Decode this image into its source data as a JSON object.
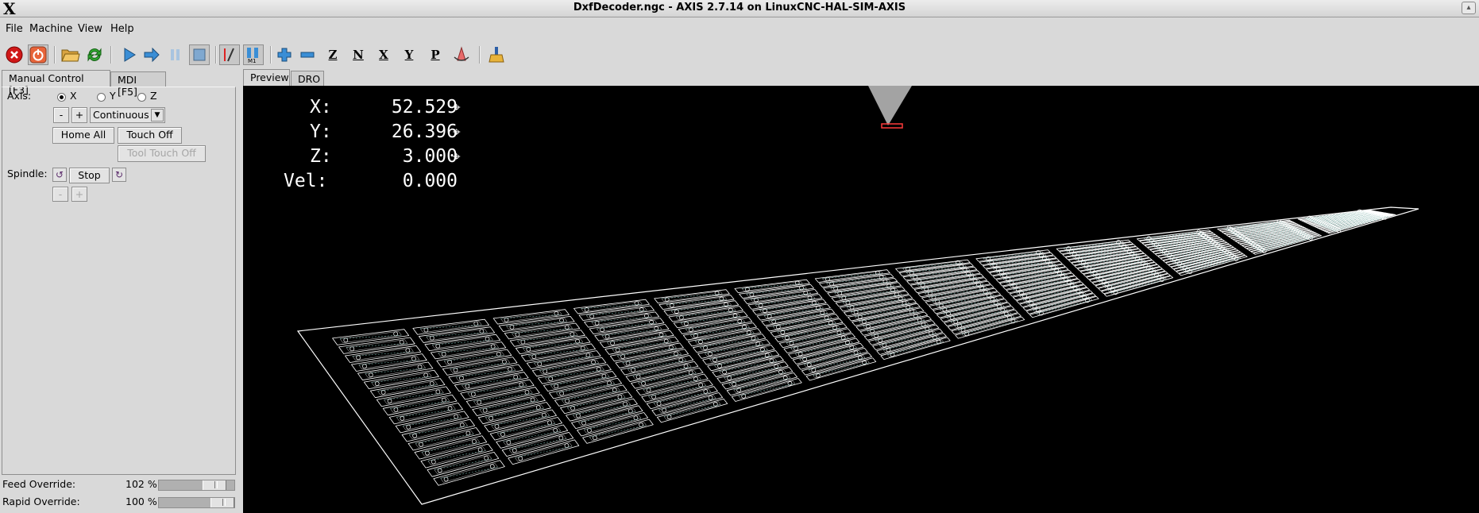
{
  "window": {
    "title": "DxfDecoder.ngc - AXIS 2.7.14 on LinuxCNC-HAL-SIM-AXIS",
    "logo": "X"
  },
  "menu": {
    "file": "File",
    "machine": "Machine",
    "view": "View",
    "help": "Help"
  },
  "toolbar": {
    "icons": [
      "estop-icon",
      "machine-power-icon",
      "open-file-icon",
      "reload-icon",
      "run-icon",
      "step-icon",
      "pause-icon",
      "stop-icon",
      "toggle-skip-lines-icon",
      "optional-stop-icon",
      "zoom-in-icon",
      "zoom-out-icon",
      "view-z-icon",
      "view-z2-icon",
      "view-x-icon",
      "view-y-icon",
      "view-p-icon",
      "rotate-view-icon",
      "clear-plot-icon"
    ],
    "view_z": "Z",
    "view_z2": "N",
    "view_x": "X",
    "view_y": "Y",
    "view_p": "P"
  },
  "tabs_left": {
    "manual": "Manual Control [F3]",
    "mdi": "MDI [F5]"
  },
  "manual": {
    "axis_label": "Axis:",
    "axis_options": [
      "X",
      "Y",
      "Z"
    ],
    "axis_selected": "X",
    "jog_minus": "-",
    "jog_plus": "+",
    "jog_mode": "Continuous",
    "home_all": "Home All",
    "touch_off": "Touch Off",
    "tool_touch_off": "Tool Touch Off",
    "spindle_label": "Spindle:",
    "spindle_stop": "Stop",
    "spindle_minus": "-",
    "spindle_plus": "+"
  },
  "overrides": {
    "feed_label": "Feed Override:",
    "feed_value": "102 %",
    "feed_fraction": 0.85,
    "rapid_label": "Rapid Override:",
    "rapid_value": "100 %",
    "rapid_fraction": 1.0
  },
  "tabs_right": {
    "preview": "Preview",
    "dro": "DRO"
  },
  "dro_readout": {
    "x_label": "X:",
    "x_value": "52.529",
    "y_label": "Y:",
    "y_value": "26.396",
    "z_label": "Z:",
    "z_value": "3.000",
    "vel_label": "Vel:",
    "vel_value": "0.000",
    "home_mark": "⌖"
  },
  "colors": {
    "preview_bg": "#000000",
    "toolpath": "#ffffff",
    "rapid": "#6fa8a0",
    "tool_cone": "#b5b5b5",
    "tool_tip": "#ff3b3b"
  }
}
